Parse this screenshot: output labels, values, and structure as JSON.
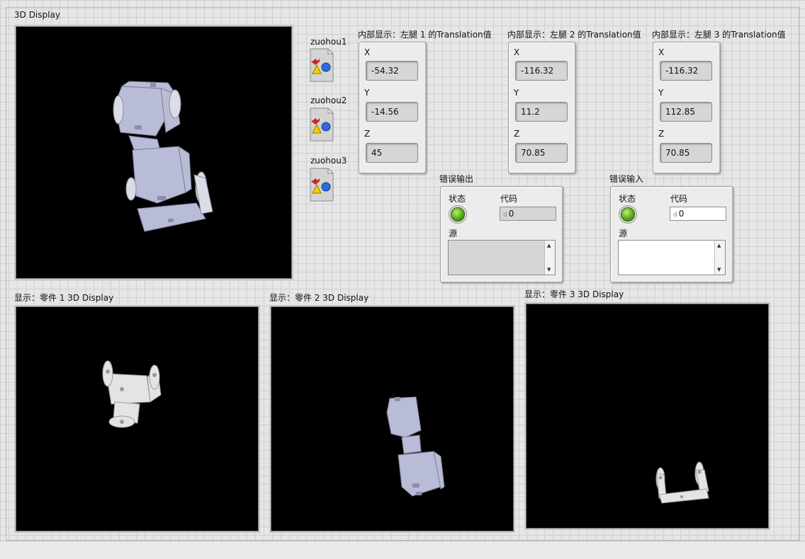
{
  "main_display": {
    "label": "3D Display"
  },
  "part_displays": [
    {
      "label": "显示：零件 1 3D Display"
    },
    {
      "label": "显示：零件 2 3D Display"
    },
    {
      "label": "显示：零件 3 3D Display"
    }
  ],
  "refnums": [
    {
      "label": "zuohou1",
      "icon": "scene-object-refnum-icon"
    },
    {
      "label": "zuohou2",
      "icon": "scene-object-refnum-icon"
    },
    {
      "label": "zuohou3",
      "icon": "scene-object-refnum-icon"
    }
  ],
  "translations": [
    {
      "title": "内部显示：左腿 1 的Translation值",
      "x_label": "X",
      "y_label": "Y",
      "z_label": "Z",
      "x": "-54.32",
      "y": "-14.56",
      "z": "45"
    },
    {
      "title": "内部显示：左腿 2 的Translation值",
      "x_label": "X",
      "y_label": "Y",
      "z_label": "Z",
      "x": "-116.32",
      "y": "11.2",
      "z": "70.85"
    },
    {
      "title": "内部显示：左腿 3 的Translation值",
      "x_label": "X",
      "y_label": "Y",
      "z_label": "Z",
      "x": "-116.32",
      "y": "112.85",
      "z": "70.85"
    }
  ],
  "error_out": {
    "title": "错误输出",
    "status_label": "状态",
    "code_label": "代码",
    "code_prefix": "d",
    "code": "0",
    "source_label": "源",
    "source": "",
    "status_color": "#5aa81a"
  },
  "error_in": {
    "title": "错误输入",
    "status_label": "状态",
    "code_label": "代码",
    "code_prefix": "d",
    "code": "0",
    "source_label": "源",
    "source": "",
    "status_color": "#5aa81a"
  },
  "colors": {
    "model_fill": "#b9bcd6",
    "bracket_fill": "#e4e4e4",
    "led_green": "#5aa81a",
    "display_bg": "#000000"
  }
}
